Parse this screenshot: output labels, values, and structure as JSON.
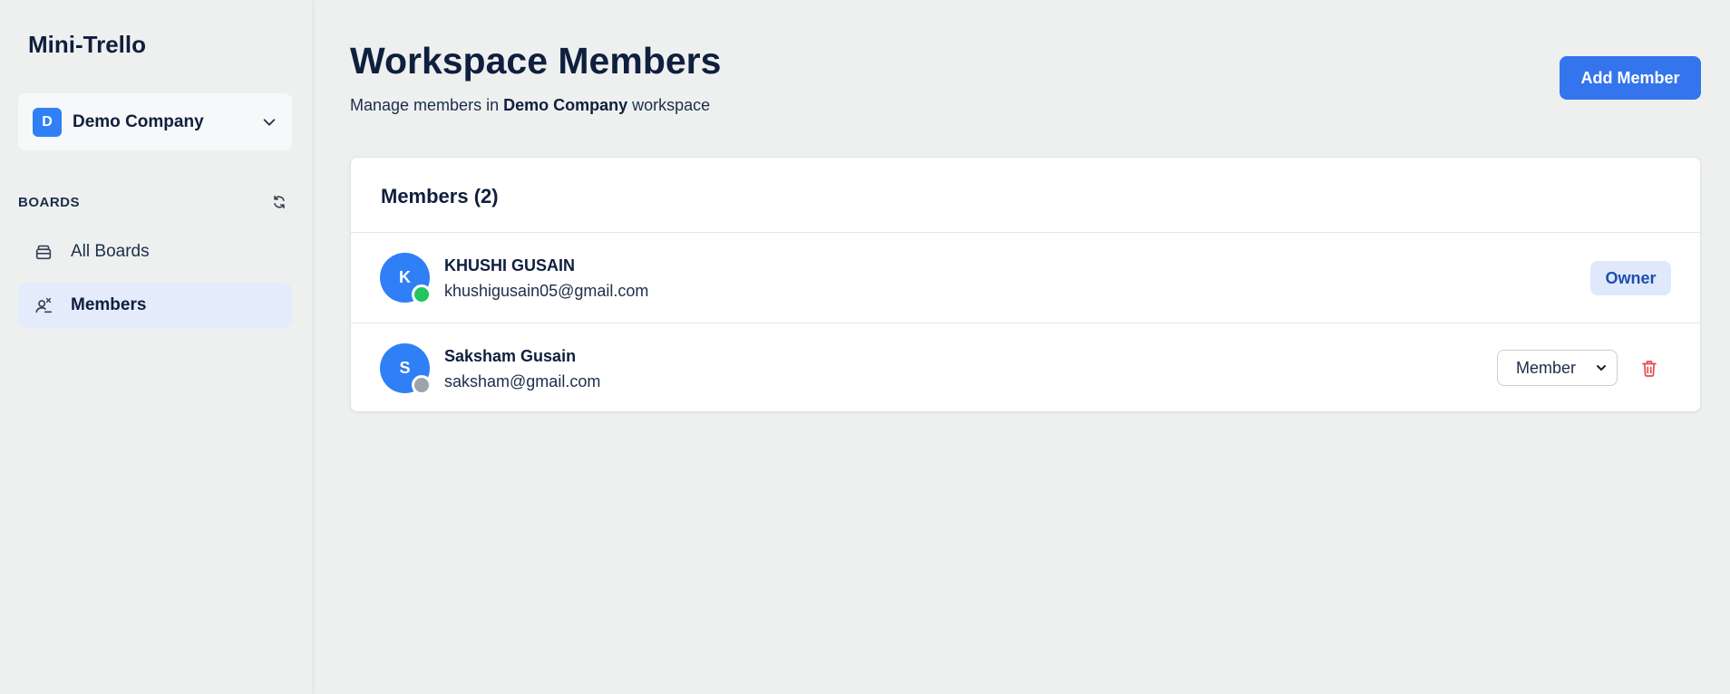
{
  "app": {
    "title": "Mini-Trello"
  },
  "workspace": {
    "initial": "D",
    "name": "Demo Company"
  },
  "sidebar": {
    "section_label": "BOARDS",
    "items": [
      {
        "label": "All Boards",
        "icon": "board-stack-icon",
        "active": false
      },
      {
        "label": "Members",
        "icon": "user-add-icon",
        "active": true
      }
    ]
  },
  "header": {
    "title": "Workspace Members",
    "subtitle_prefix": "Manage members in ",
    "subtitle_workspace": "Demo Company",
    "subtitle_suffix": " workspace",
    "add_button": "Add Member"
  },
  "members_card": {
    "title": "Members (2)",
    "members": [
      {
        "initial": "K",
        "name": "KHUSHI GUSAIN",
        "email": "khushigusain05@gmail.com",
        "status": "online",
        "status_color": "#22c55e",
        "role": "Owner"
      },
      {
        "initial": "S",
        "name": "Saksham Gusain",
        "email": "saksham@gmail.com",
        "status": "offline",
        "status_color": "#9ca3af",
        "role": "Member"
      }
    ]
  },
  "colors": {
    "accent": "#3474ec",
    "avatar": "#2f7ff6",
    "active_nav": "#e4ecfb",
    "danger": "#e5484d"
  }
}
